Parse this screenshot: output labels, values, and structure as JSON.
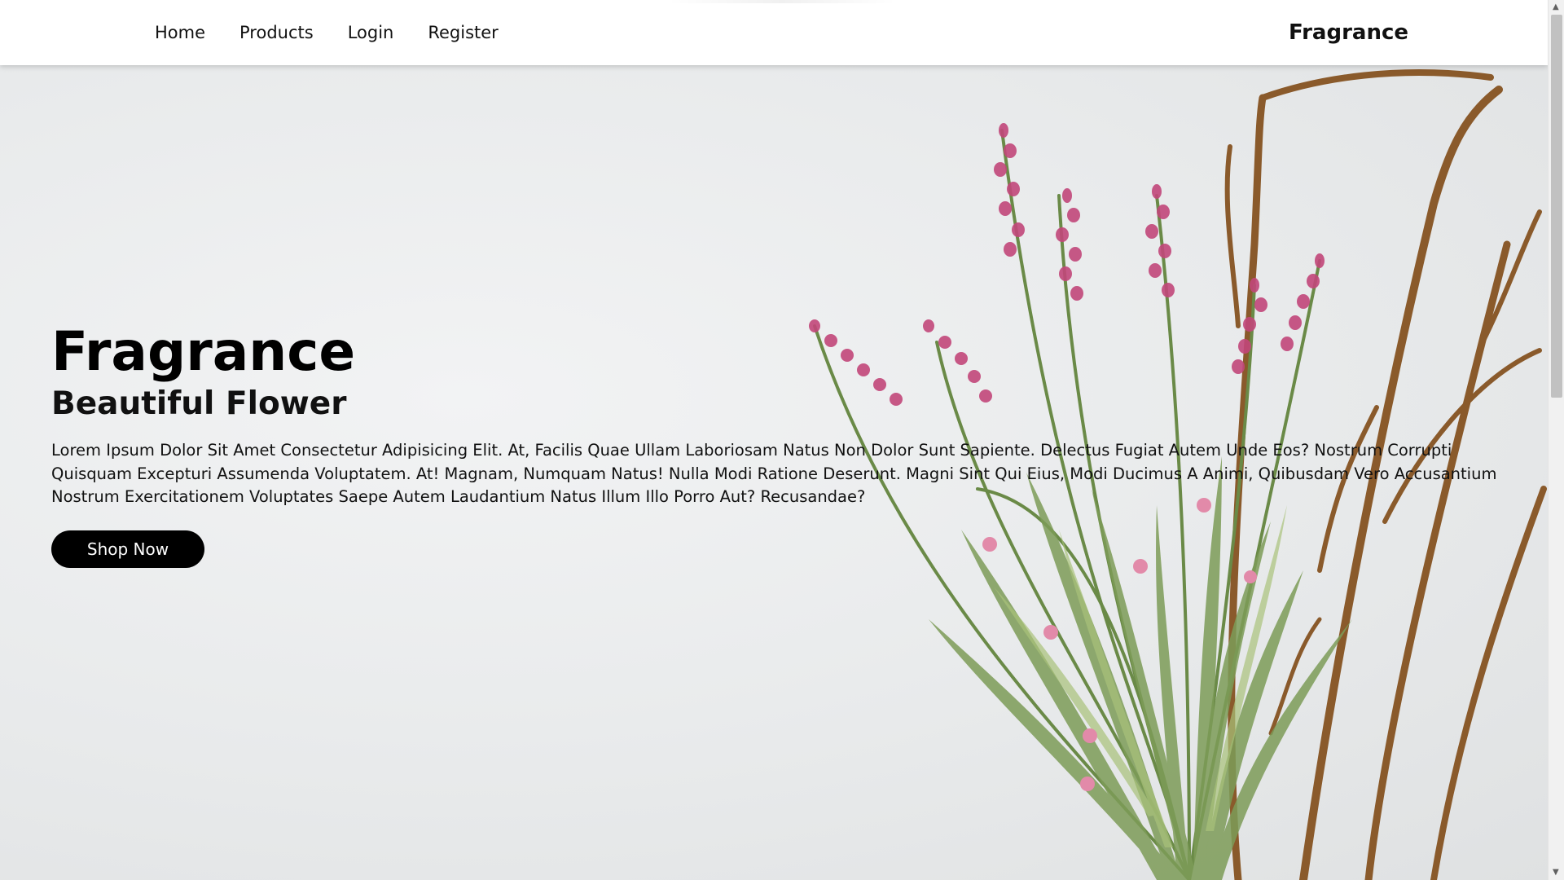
{
  "nav": {
    "links": [
      {
        "label": "Home"
      },
      {
        "label": "Products"
      },
      {
        "label": "Login"
      },
      {
        "label": "Register"
      }
    ],
    "brand": "Fragrance"
  },
  "hero": {
    "title": "Fragrance",
    "subtitle": "Beautiful Flower",
    "description": "Lorem Ipsum Dolor Sit Amet Consectetur Adipisicing Elit. At, Facilis Quae Ullam Laboriosam Natus Non Dolor Sunt Sapiente. Delectus Fugiat Autem Unde Eos? Nostrum Corrupti Quisquam Excepturi Assumenda Voluptatem. At! Magnam, Numquam Natus! Nulla Modi Ratione Deserunt. Magni Sint Qui Eius, Modi Ducimus A Animi, Quibusdam Vero Accusantium Nostrum Exercitationem Voluptates Saepe Autem Laudantium Natus Illum Illo Porro Aut? Recusandae?",
    "cta_label": "Shop Now"
  },
  "colors": {
    "background": "#e9ebec",
    "button": "#000000",
    "button_text": "#ffffff",
    "flower_pink": "#c2477a",
    "foliage": "#6f8f4e",
    "branch": "#8a5a2b"
  },
  "icons": {
    "scroll_up": "triangle-up",
    "scroll_down": "triangle-down"
  }
}
